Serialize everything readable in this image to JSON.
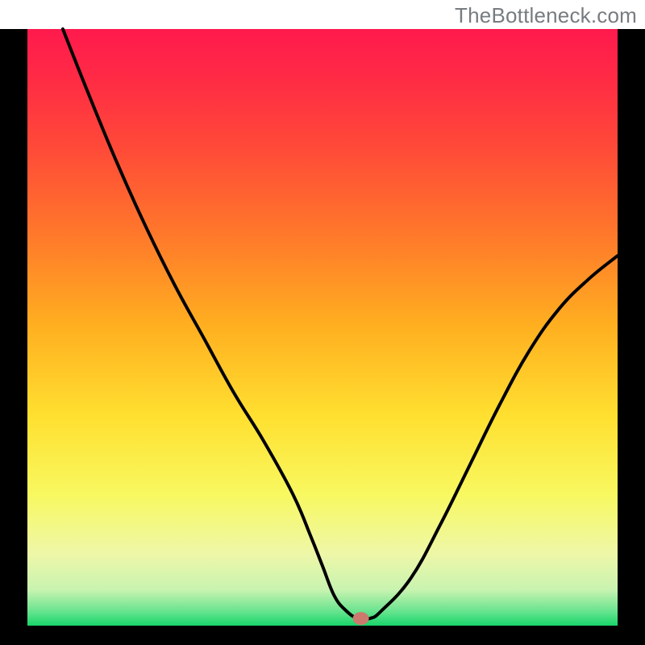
{
  "watermark": "TheBottleneck.com",
  "chart_data": {
    "type": "line",
    "title": "",
    "xlabel": "",
    "ylabel": "",
    "xlim": [
      0,
      100
    ],
    "ylim": [
      0,
      100
    ],
    "grid": false,
    "legend": false,
    "notes": "V-shaped curve over a vertical rainbow gradient (red top → green bottom) framed by black borders on left, right and bottom. Small rounded marker near the minimum. No visible numeric axes, ticks or labels.",
    "series": [
      {
        "name": "curve",
        "x": [
          6,
          10,
          15,
          20,
          25,
          30,
          35,
          40,
          45,
          48,
          50,
          52,
          54,
          56,
          58,
          60,
          65,
          70,
          75,
          80,
          85,
          90,
          95,
          100
        ],
        "y": [
          100,
          90,
          78,
          67,
          57,
          48,
          39,
          31,
          22,
          15,
          10,
          5,
          2.5,
          1.2,
          1.2,
          2.5,
          8,
          17,
          27,
          37,
          46,
          53,
          58,
          62
        ]
      }
    ],
    "marker": {
      "x": 56.5,
      "y": 1.2,
      "color": "#cc7a6e"
    },
    "gradient_stops": [
      {
        "offset": 0.0,
        "color": "#ff1a4d"
      },
      {
        "offset": 0.08,
        "color": "#ff2a45"
      },
      {
        "offset": 0.2,
        "color": "#ff4a38"
      },
      {
        "offset": 0.35,
        "color": "#ff7a2a"
      },
      {
        "offset": 0.5,
        "color": "#ffb020"
      },
      {
        "offset": 0.65,
        "color": "#ffe030"
      },
      {
        "offset": 0.78,
        "color": "#f8f860"
      },
      {
        "offset": 0.88,
        "color": "#eef7a8"
      },
      {
        "offset": 0.94,
        "color": "#c8f3b0"
      },
      {
        "offset": 0.975,
        "color": "#6be490"
      },
      {
        "offset": 1.0,
        "color": "#18d66a"
      }
    ],
    "frame": {
      "outer": 800,
      "inner_left": 34,
      "inner_right": 766,
      "inner_top": 36,
      "inner_bottom": 776,
      "border_thickness": 34
    }
  }
}
